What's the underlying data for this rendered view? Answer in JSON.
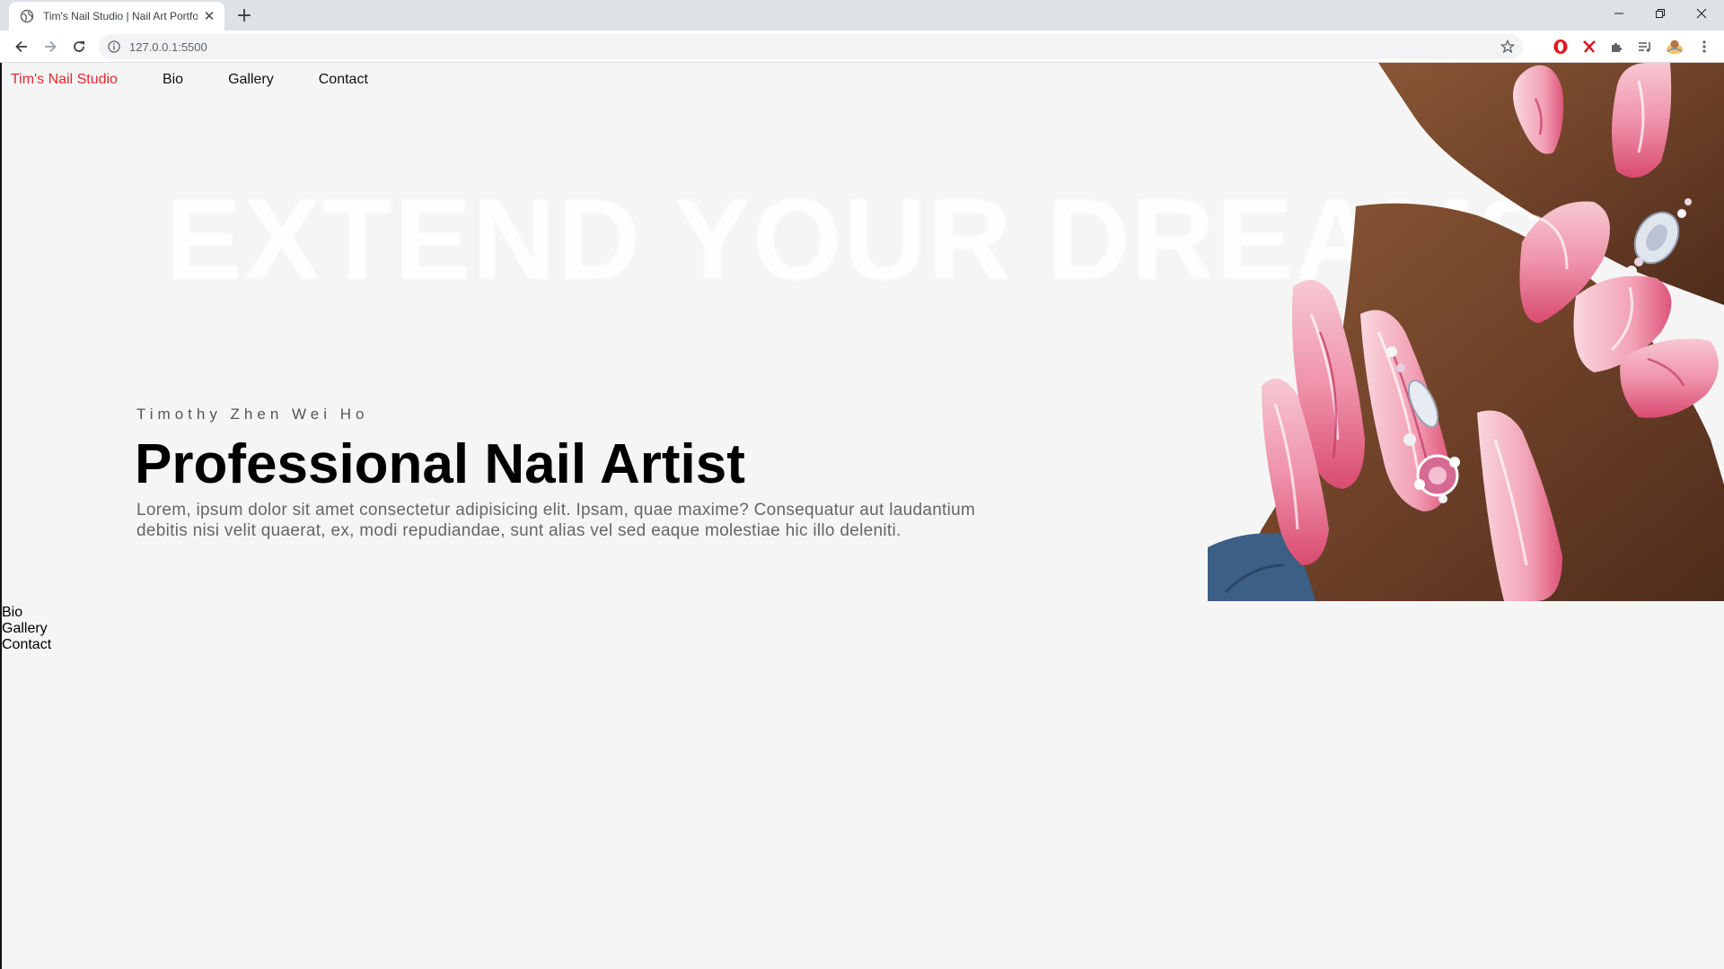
{
  "browser": {
    "tab_title": "Tim's Nail Studio | Nail Art Portfolio",
    "tab_close": "✕",
    "new_tab": "+",
    "url": "127.0.0.1:5500",
    "window_controls": {
      "minimize": "–",
      "restore": "❐",
      "close": "✕"
    }
  },
  "site": {
    "nav": {
      "brand": "Tim's Nail Studio",
      "links": [
        "Bio",
        "Gallery",
        "Contact"
      ],
      "brand_color": "#e3262e"
    },
    "hero": {
      "background_text": "EXTEND YOUR DREAMS.",
      "subtitle": "Timothy Zhen Wei Ho",
      "title": "Professional Nail Artist",
      "description": "Lorem, ipsum dolor sit amet consectetur adipisicing elit. Ipsam, quae maxime? Consequatur aut laudantium debitis nisi velit quaerat, ex, modi repudiandae, sunt alias vel sed eaque molestiae hic illo deleniti."
    },
    "footer_links": [
      "Bio",
      "Gallery",
      "Contact"
    ]
  }
}
